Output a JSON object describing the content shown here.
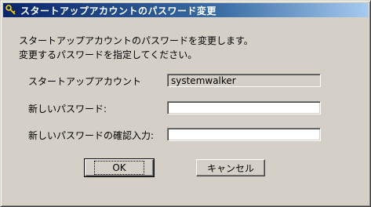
{
  "window": {
    "title": "スタートアップアカウントのパスワード変更",
    "icon": "key-icon"
  },
  "description": {
    "line1": "スタートアップアカウントのパスワードを変更します。",
    "line2": "変更するパスワードを指定してください。"
  },
  "form": {
    "account_label": "スタートアップアカウント",
    "account_value": "systemwalker",
    "new_password_label": "新しいパスワード:",
    "confirm_password_label": "新しいパスワードの確認入力:"
  },
  "buttons": {
    "ok_label": "OK",
    "cancel_label": "キャンセル"
  }
}
